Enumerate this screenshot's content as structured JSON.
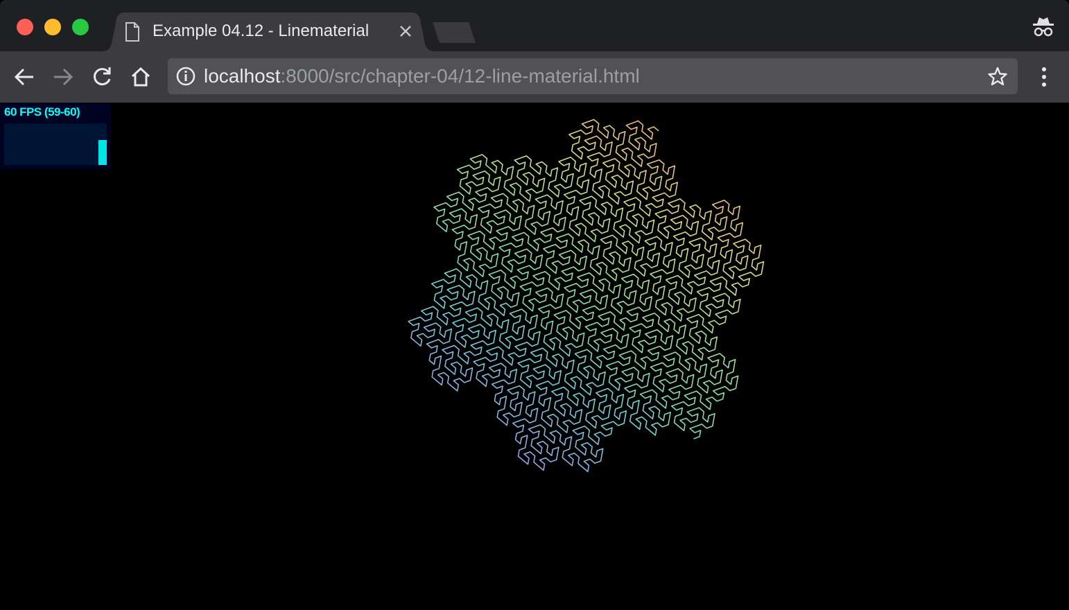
{
  "browser": {
    "tab": {
      "title": "Example 04.12 - Linematerial"
    },
    "address_bar": {
      "host": "localhost",
      "path": ":8000/src/chapter-04/12-line-material.html"
    },
    "icons": {
      "back": "arrow-left-icon",
      "forward": "arrow-right-icon",
      "reload": "reload-icon",
      "home": "home-icon",
      "info": "info-icon",
      "bookmark": "star-icon",
      "menu": "vertical-ellipsis-icon",
      "incognito": "incognito-icon",
      "close": "close-icon"
    },
    "colors": {
      "fps_text": "#00ffff",
      "fps_bar": "#00e6e6",
      "fps_bg": "#000222"
    }
  },
  "stats": {
    "fps_label": "60 FPS (59-60)",
    "fps_value": 60,
    "fps_max": 60
  }
}
